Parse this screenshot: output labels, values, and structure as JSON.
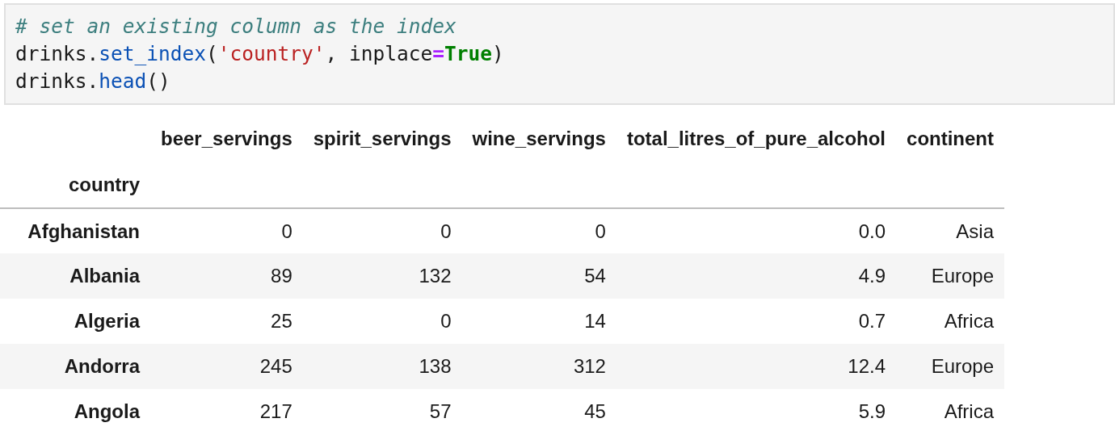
{
  "code_cell": {
    "lines": [
      [
        {
          "kind": "comment",
          "text": "# set an existing column as the index"
        }
      ],
      [
        {
          "kind": "plain",
          "text": "drinks."
        },
        {
          "kind": "attr",
          "text": "set_index"
        },
        {
          "kind": "plain",
          "text": "("
        },
        {
          "kind": "string",
          "text": "'country'"
        },
        {
          "kind": "plain",
          "text": ", inplace"
        },
        {
          "kind": "operator",
          "text": "="
        },
        {
          "kind": "keyword",
          "text": "True"
        },
        {
          "kind": "plain",
          "text": ")"
        }
      ],
      [
        {
          "kind": "plain",
          "text": "drinks."
        },
        {
          "kind": "attr",
          "text": "head"
        },
        {
          "kind": "plain",
          "text": "()"
        }
      ]
    ]
  },
  "table": {
    "columns": [
      "beer_servings",
      "spirit_servings",
      "wine_servings",
      "total_litres_of_pure_alcohol",
      "continent"
    ],
    "index_name": "country",
    "rows": [
      {
        "index": "Afghanistan",
        "cells": [
          "0",
          "0",
          "0",
          "0.0",
          "Asia"
        ]
      },
      {
        "index": "Albania",
        "cells": [
          "89",
          "132",
          "54",
          "4.9",
          "Europe"
        ]
      },
      {
        "index": "Algeria",
        "cells": [
          "25",
          "0",
          "14",
          "0.7",
          "Africa"
        ]
      },
      {
        "index": "Andorra",
        "cells": [
          "245",
          "138",
          "312",
          "12.4",
          "Europe"
        ]
      },
      {
        "index": "Angola",
        "cells": [
          "217",
          "57",
          "45",
          "5.9",
          "Africa"
        ]
      }
    ]
  }
}
